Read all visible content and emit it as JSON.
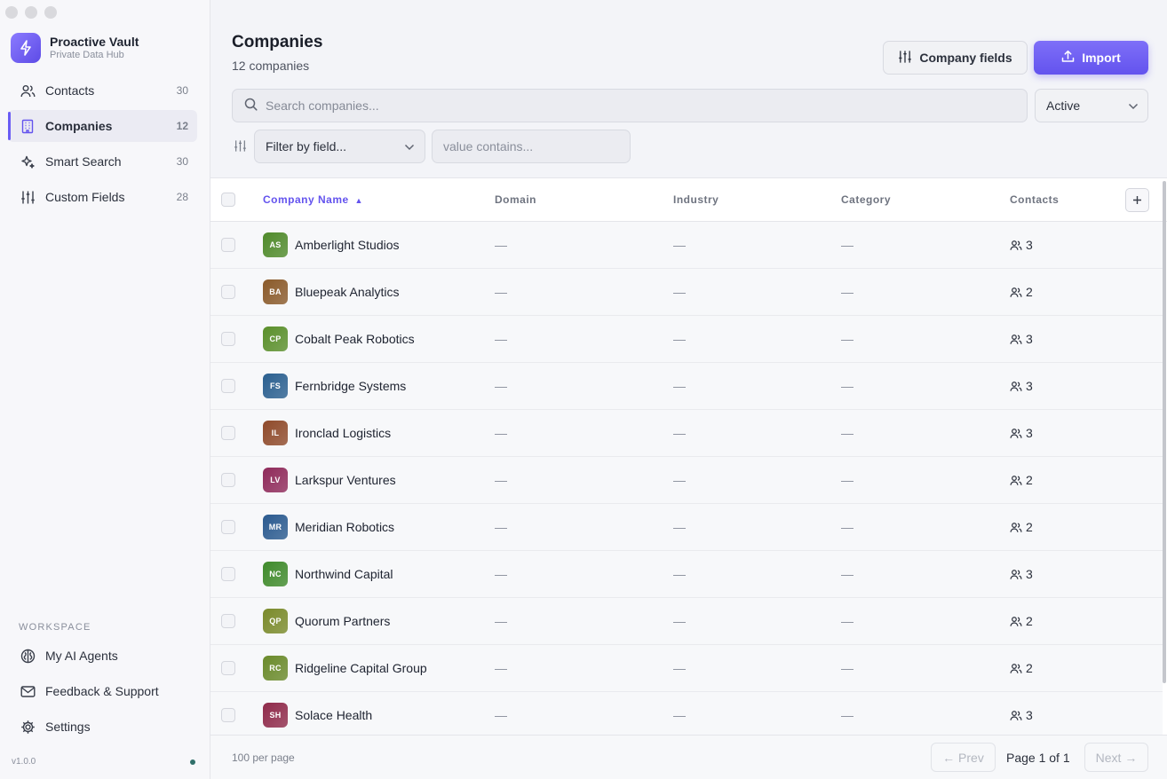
{
  "app": {
    "name": "Proactive Vault",
    "subtitle": "Private Data Hub",
    "version": "v1.0.0"
  },
  "sidebar": {
    "items": [
      {
        "label": "Contacts",
        "count": "30",
        "icon": "users-icon"
      },
      {
        "label": "Companies",
        "count": "12",
        "icon": "building-icon",
        "active": true
      },
      {
        "label": "Smart Search",
        "count": "30",
        "icon": "sparkles-icon"
      },
      {
        "label": "Custom Fields",
        "count": "28",
        "icon": "sliders-icon"
      }
    ],
    "workspace_label": "WORKSPACE",
    "workspace_items": [
      {
        "label": "My AI Agents",
        "icon": "brain-icon"
      },
      {
        "label": "Feedback & Support",
        "icon": "mail-icon"
      },
      {
        "label": "Settings",
        "icon": "gear-icon"
      }
    ]
  },
  "header": {
    "title": "Companies",
    "subtitle": "12 companies",
    "fields_button": "Company fields",
    "import_button": "Import"
  },
  "search": {
    "placeholder": "Search companies...",
    "status_value": "Active"
  },
  "filter": {
    "field_placeholder": "Filter by field...",
    "value_placeholder": "value contains..."
  },
  "table": {
    "columns": [
      "Company Name",
      "Domain",
      "Industry",
      "Category",
      "Contacts"
    ],
    "sort_indicator": "▲",
    "empty_value": "—",
    "rows": [
      {
        "initials": "AS",
        "name": "Amberlight Studios",
        "contacts": "3",
        "color": "#4f8a2a"
      },
      {
        "initials": "BA",
        "name": "Bluepeak Analytics",
        "contacts": "2",
        "color": "#8a5a2a"
      },
      {
        "initials": "CP",
        "name": "Cobalt Peak Robotics",
        "contacts": "3",
        "color": "#5a8f2a"
      },
      {
        "initials": "FS",
        "name": "Fernbridge Systems",
        "contacts": "3",
        "color": "#2a5f8f"
      },
      {
        "initials": "IL",
        "name": "Ironclad Logistics",
        "contacts": "3",
        "color": "#8f4a2a"
      },
      {
        "initials": "LV",
        "name": "Larkspur Ventures",
        "contacts": "2",
        "color": "#8f2a5a"
      },
      {
        "initials": "MR",
        "name": "Meridian Robotics",
        "contacts": "2",
        "color": "#2a5a8f"
      },
      {
        "initials": "NC",
        "name": "Northwind Capital",
        "contacts": "3",
        "color": "#3f8a2a"
      },
      {
        "initials": "QP",
        "name": "Quorum Partners",
        "contacts": "2",
        "color": "#7a8a2a"
      },
      {
        "initials": "RC",
        "name": "Ridgeline Capital Group",
        "contacts": "2",
        "color": "#6a8a2a"
      },
      {
        "initials": "SH",
        "name": "Solace Health",
        "contacts": "3",
        "color": "#8f2a4a"
      }
    ]
  },
  "footer": {
    "per_page": "100 per page",
    "prev": "← Prev",
    "page_info": "Page 1 of 1",
    "next": "Next →"
  },
  "colors": {
    "accent": "#6353ee",
    "sidebar_bg": "#f7f7fa",
    "main_bg": "#f3f4f8"
  }
}
